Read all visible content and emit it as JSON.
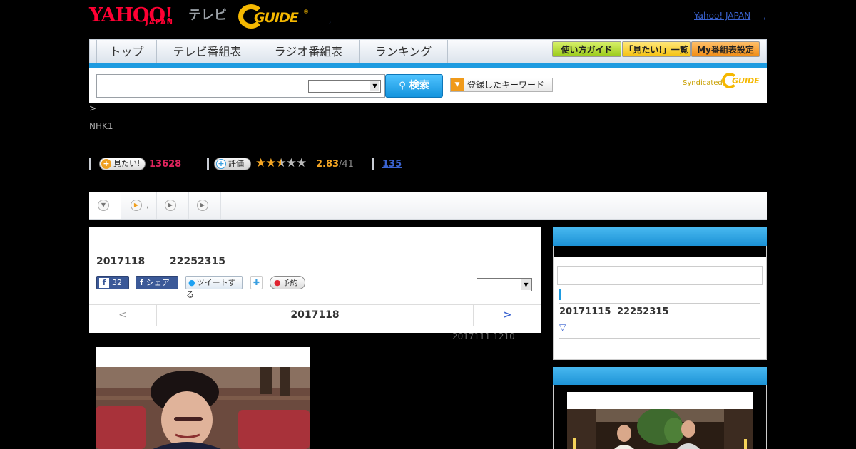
{
  "header": {
    "logo_yahoo": "YAHOO!",
    "logo_japan": "JAPAN",
    "logo_tv": "テレビ",
    "logo_gguide": "GUIDE",
    "logo_reg": "®",
    "separator_dot": ",",
    "yahoo_japan_link": "Yahoo! JAPAN",
    "yahoo_japan_link_suffix": ","
  },
  "nav": {
    "tabs": [
      "トップ",
      "テレビ番組表",
      "ラジオ番組表",
      "ランキング"
    ],
    "guide_buttons": [
      "使い方ガイド",
      "「見たい!」一覧",
      "My番組表設定"
    ],
    "accent_color": "#1e9be0"
  },
  "search": {
    "input_value": "",
    "select_value": "",
    "search_label": "検索",
    "keyword_label": "登録したキーワード",
    "syndicated_label": "Syndicated",
    "syndicated_guide": "GUIDE"
  },
  "program": {
    "breadcrumb": ">",
    "channel": "NHK1"
  },
  "stats": {
    "want_label": "見たい!",
    "want_count": "13628",
    "rate_label": "評価",
    "stars_filled": 2.83,
    "rating": "2.83",
    "rating_of": "/41",
    "reviews": "135",
    "star_color": "#f5a623",
    "want_color": "#e0245e"
  },
  "subtabs": {
    "dot": ","
  },
  "main": {
    "air_date": "2017118",
    "air_time": "22252315",
    "fb_like_count": "32",
    "fb_share_label": "シェア",
    "tweet_label": "ツイートする",
    "reserve_label": "予約",
    "select_value": "",
    "prev_label": "<",
    "current_date": "2017118",
    "next_label": ">",
    "update_text": "2017111  1210"
  },
  "sidebar": {
    "input_value": "",
    "air_date": "20171115",
    "air_time": "22252315",
    "more_label": "▽　"
  }
}
